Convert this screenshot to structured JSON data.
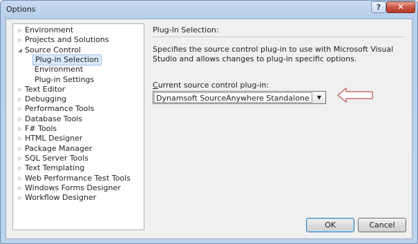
{
  "window": {
    "title": "Options"
  },
  "titlebar": {
    "help_glyph": "?",
    "close_glyph": "✕"
  },
  "tree": {
    "items": [
      {
        "label": "Environment",
        "level": 0,
        "expander": "▷"
      },
      {
        "label": "Projects and Solutions",
        "level": 0,
        "expander": "▷"
      },
      {
        "label": "Source Control",
        "level": 0,
        "expander": "◢"
      },
      {
        "label": "Plug-in Selection",
        "level": 1,
        "selected": true
      },
      {
        "label": "Environment",
        "level": 1
      },
      {
        "label": "Plug-in Settings",
        "level": 1
      },
      {
        "label": "Text Editor",
        "level": 0,
        "expander": "▷"
      },
      {
        "label": "Debugging",
        "level": 0,
        "expander": "▷"
      },
      {
        "label": "Performance Tools",
        "level": 0,
        "expander": "▷"
      },
      {
        "label": "Database Tools",
        "level": 0,
        "expander": "▷"
      },
      {
        "label": "F# Tools",
        "level": 0,
        "expander": "▷"
      },
      {
        "label": "HTML Designer",
        "level": 0,
        "expander": "▷"
      },
      {
        "label": "Package Manager",
        "level": 0,
        "expander": "▷"
      },
      {
        "label": "SQL Server Tools",
        "level": 0,
        "expander": "▷"
      },
      {
        "label": "Text Templating",
        "level": 0,
        "expander": "▷"
      },
      {
        "label": "Web Performance Test Tools",
        "level": 0,
        "expander": "▷"
      },
      {
        "label": "Windows Forms Designer",
        "level": 0,
        "expander": "▷"
      },
      {
        "label": "Workflow Designer",
        "level": 0,
        "expander": "▷"
      }
    ]
  },
  "panel": {
    "heading": "Plug-In Selection:",
    "description": "Specifies the source control plug-in to use with Microsoft Visual Studio and allows changes to plug-in specific options.",
    "combo_label_accel": "C",
    "combo_label_rest": "urrent source control plug-in:",
    "combo_value": "Dynamsoft SourceAnywhere Standalone",
    "combo_arrow": "▼"
  },
  "buttons": {
    "ok": "OK",
    "cancel": "Cancel"
  },
  "colors": {
    "arrow_outline": "#c0504d",
    "selection_fill": "#d9e9fb",
    "title_bar": "#c9dcf2"
  },
  "icons": {
    "pointer": "arrow-left-icon"
  }
}
